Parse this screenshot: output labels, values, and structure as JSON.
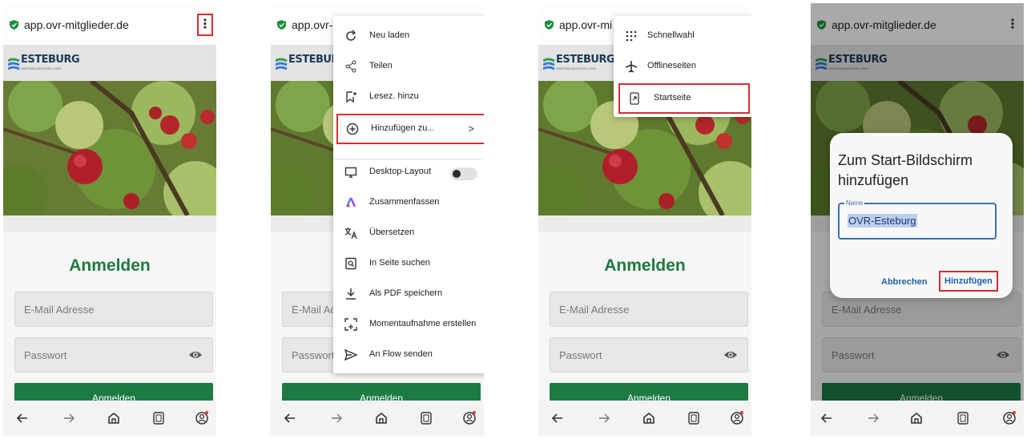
{
  "browser": {
    "url": "app.ovr-mitglieder.de",
    "url_truncated": "app.ovr-",
    "url_truncated_3": "app.ovr-mi"
  },
  "brand": {
    "logo_text": "ESTEBURG",
    "logo_sub": "OBSTBAUZENTRUM JORK"
  },
  "login": {
    "title": "Anmelden",
    "email_placeholder": "E-Mail Adresse",
    "email_partial": "E-Mail Ac",
    "email_obscured": "E-Mail Adresse",
    "password_placeholder": "Passwort",
    "password_partial": "Passwort",
    "submit": "Anmelden"
  },
  "menu": {
    "items": [
      {
        "label": "Neu laden",
        "icon": "reload-icon"
      },
      {
        "label": "Teilen",
        "icon": "share-icon"
      },
      {
        "label": "Lesez. hinzu",
        "icon": "bookmark-add-icon"
      },
      {
        "label": "Hinzufügen zu...",
        "icon": "add-circle-icon"
      },
      {
        "label": "Desktop-Layout",
        "icon": "desktop-icon"
      },
      {
        "label": "Zusammenfassen",
        "icon": "summarize-icon"
      },
      {
        "label": "Übersetzen",
        "icon": "translate-icon"
      },
      {
        "label": "In Seite suchen",
        "icon": "find-in-page-icon"
      },
      {
        "label": "Als PDF speichern",
        "icon": "download-icon"
      },
      {
        "label": "Momentaufnahme erstellen",
        "icon": "screenshot-icon"
      },
      {
        "label": "An Flow senden",
        "icon": "send-icon"
      }
    ],
    "desktop_layout_on": false
  },
  "submenu": {
    "items": [
      {
        "label": "Schnellwahl",
        "icon": "speed-dial-icon"
      },
      {
        "label": "Offlineseiten",
        "icon": "airplane-icon"
      },
      {
        "label": "Startseite",
        "icon": "home-screen-icon"
      }
    ]
  },
  "dialog": {
    "title": "Zum Start-Bildschirm hinzufügen",
    "name_label": "Name",
    "name_value": "OVR-Esteburg",
    "cancel": "Abbrechen",
    "add": "Hinzufügen"
  },
  "colors": {
    "brand_green": "#1d7a44",
    "title_green": "#1f7a3f",
    "highlight_red": "#d32f2f",
    "link_blue": "#1d5fad"
  }
}
